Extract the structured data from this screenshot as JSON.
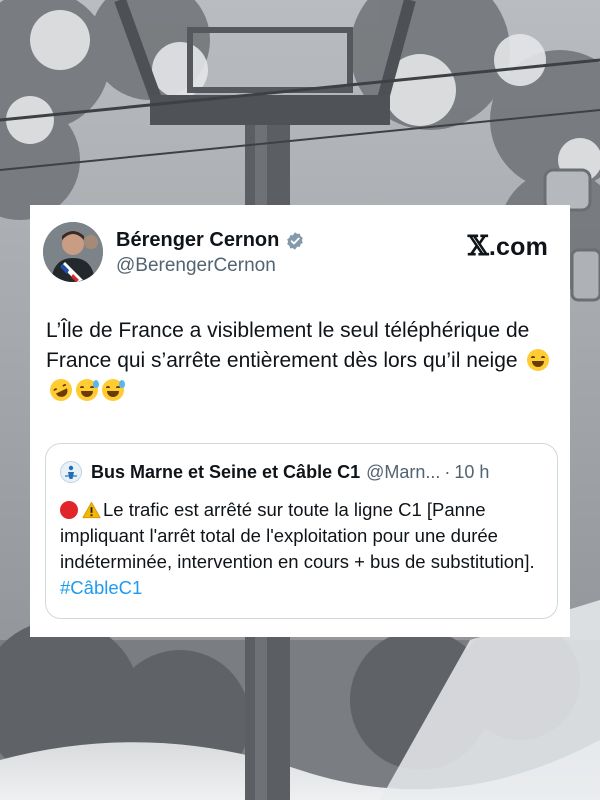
{
  "tweet": {
    "author_name": "Bérenger Cernon",
    "author_handle": "@BerengerCernon",
    "brand_glyph": "𝕏",
    "brand_suffix": ".com",
    "text": "L’Île de France a visiblement le seul téléphérique de France qui s’arrête entièrement dès lors qu’il neige",
    "emojis": [
      "laughing-face-emoji",
      "rolling-on-floor-laughing-emoji",
      "grinning-sweat-emoji",
      "grinning-sweat-emoji"
    ],
    "verified_icon": "verified-badge-icon",
    "colors": {
      "text": "#0f1419",
      "secondary": "#536471",
      "link": "#1d9bf0",
      "verified": "#829aab"
    }
  },
  "quote": {
    "author_name": "Bus Marne et Seine et Câble C1",
    "author_handle": "@Marn...",
    "separator": "·",
    "time": "10 h",
    "icons": [
      "red-circle-icon",
      "warning-icon"
    ],
    "text_main": "Le trafic est arrêté sur toute la ligne C1 [Panne impliquant l'arrêt total de l'exploitation pour une durée indéterminée, intervention en cours + bus de substitution].",
    "hashtag": "#CâbleC1"
  }
}
